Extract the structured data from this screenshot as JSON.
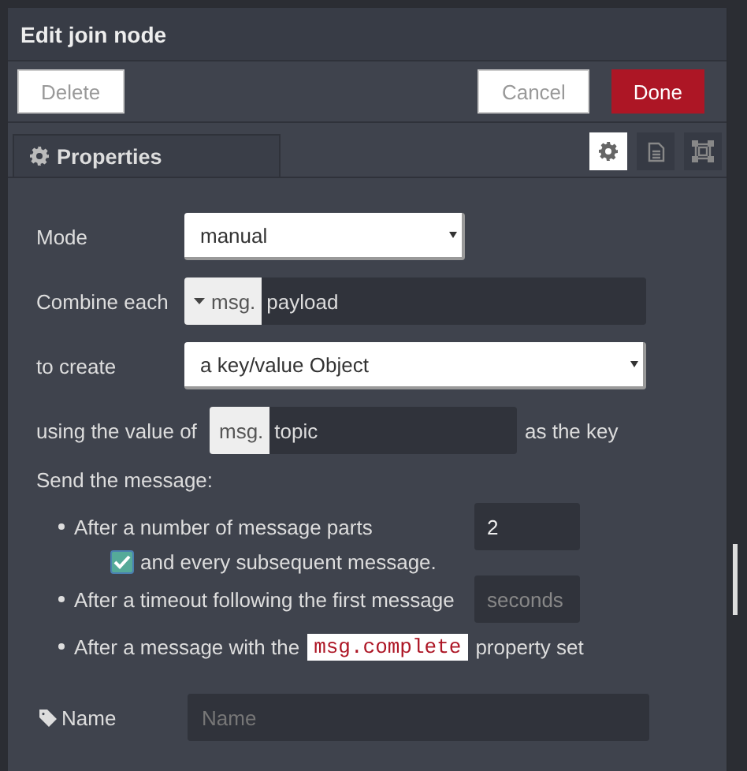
{
  "dialog": {
    "title": "Edit join node"
  },
  "buttons": [
    {
      "label": "Delete",
      "kind": "plain"
    },
    {
      "label": "Cancel",
      "kind": "plain"
    },
    {
      "label": "Done",
      "kind": "primary"
    }
  ],
  "tabs": [
    {
      "label": "Properties",
      "selected": true
    }
  ],
  "tab_icons": [
    {
      "kind": "gear",
      "selected": true
    },
    {
      "kind": "document",
      "selected": false
    },
    {
      "kind": "frame",
      "selected": false
    }
  ],
  "mode": {
    "label": "Mode",
    "value": "manual"
  },
  "combine": {
    "label": "Combine each",
    "prefix": "msg.",
    "value": "payload"
  },
  "create": {
    "label": "to create",
    "value": "a key/value Object"
  },
  "key": {
    "label": "using the value of",
    "prefix": "msg.",
    "value": "topic",
    "suffix": "as the key"
  },
  "send": {
    "heading": "Send the message:",
    "rules": [
      {
        "kind": "input",
        "text": "After a number of message parts",
        "value": "2"
      },
      {
        "kind": "check",
        "text": "and every subsequent message.",
        "checked": true
      },
      {
        "kind": "input",
        "text": "After a timeout following the first message",
        "placeholder": "seconds"
      },
      {
        "kind": "code",
        "text": "After a message with the",
        "code": "msg.complete",
        "after": "property set"
      }
    ]
  },
  "name": {
    "label": "Name",
    "placeholder": "Name"
  }
}
